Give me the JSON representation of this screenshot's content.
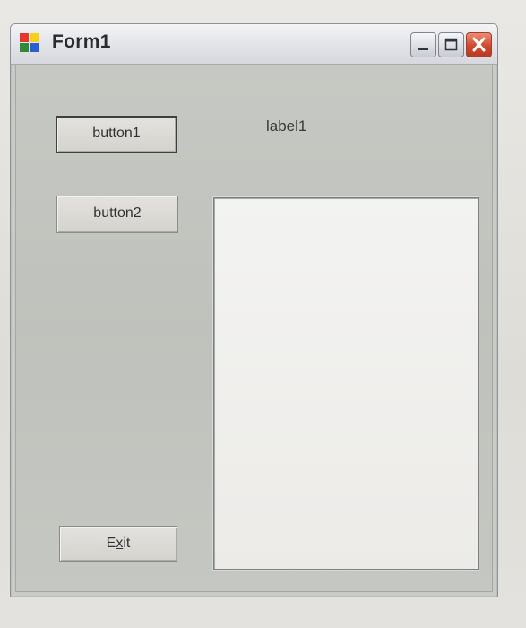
{
  "window": {
    "title": "Form1",
    "icon": "form-app-icon",
    "caption_buttons": [
      {
        "name": "minimize",
        "icon": "minimize-icon"
      },
      {
        "name": "maximize",
        "icon": "maximize-icon"
      },
      {
        "name": "close",
        "icon": "close-icon"
      }
    ]
  },
  "form": {
    "button1_label": "button1",
    "button2_label": "button2",
    "label1_text": "label1",
    "exit_label_prefix": "E",
    "exit_label_accel": "x",
    "exit_label_suffix": "it",
    "listbox_items": []
  },
  "colors": {
    "close_button": "#cf4a2f",
    "client_background": "#c3c5c0",
    "listbox_background": "#f0f0ee"
  }
}
